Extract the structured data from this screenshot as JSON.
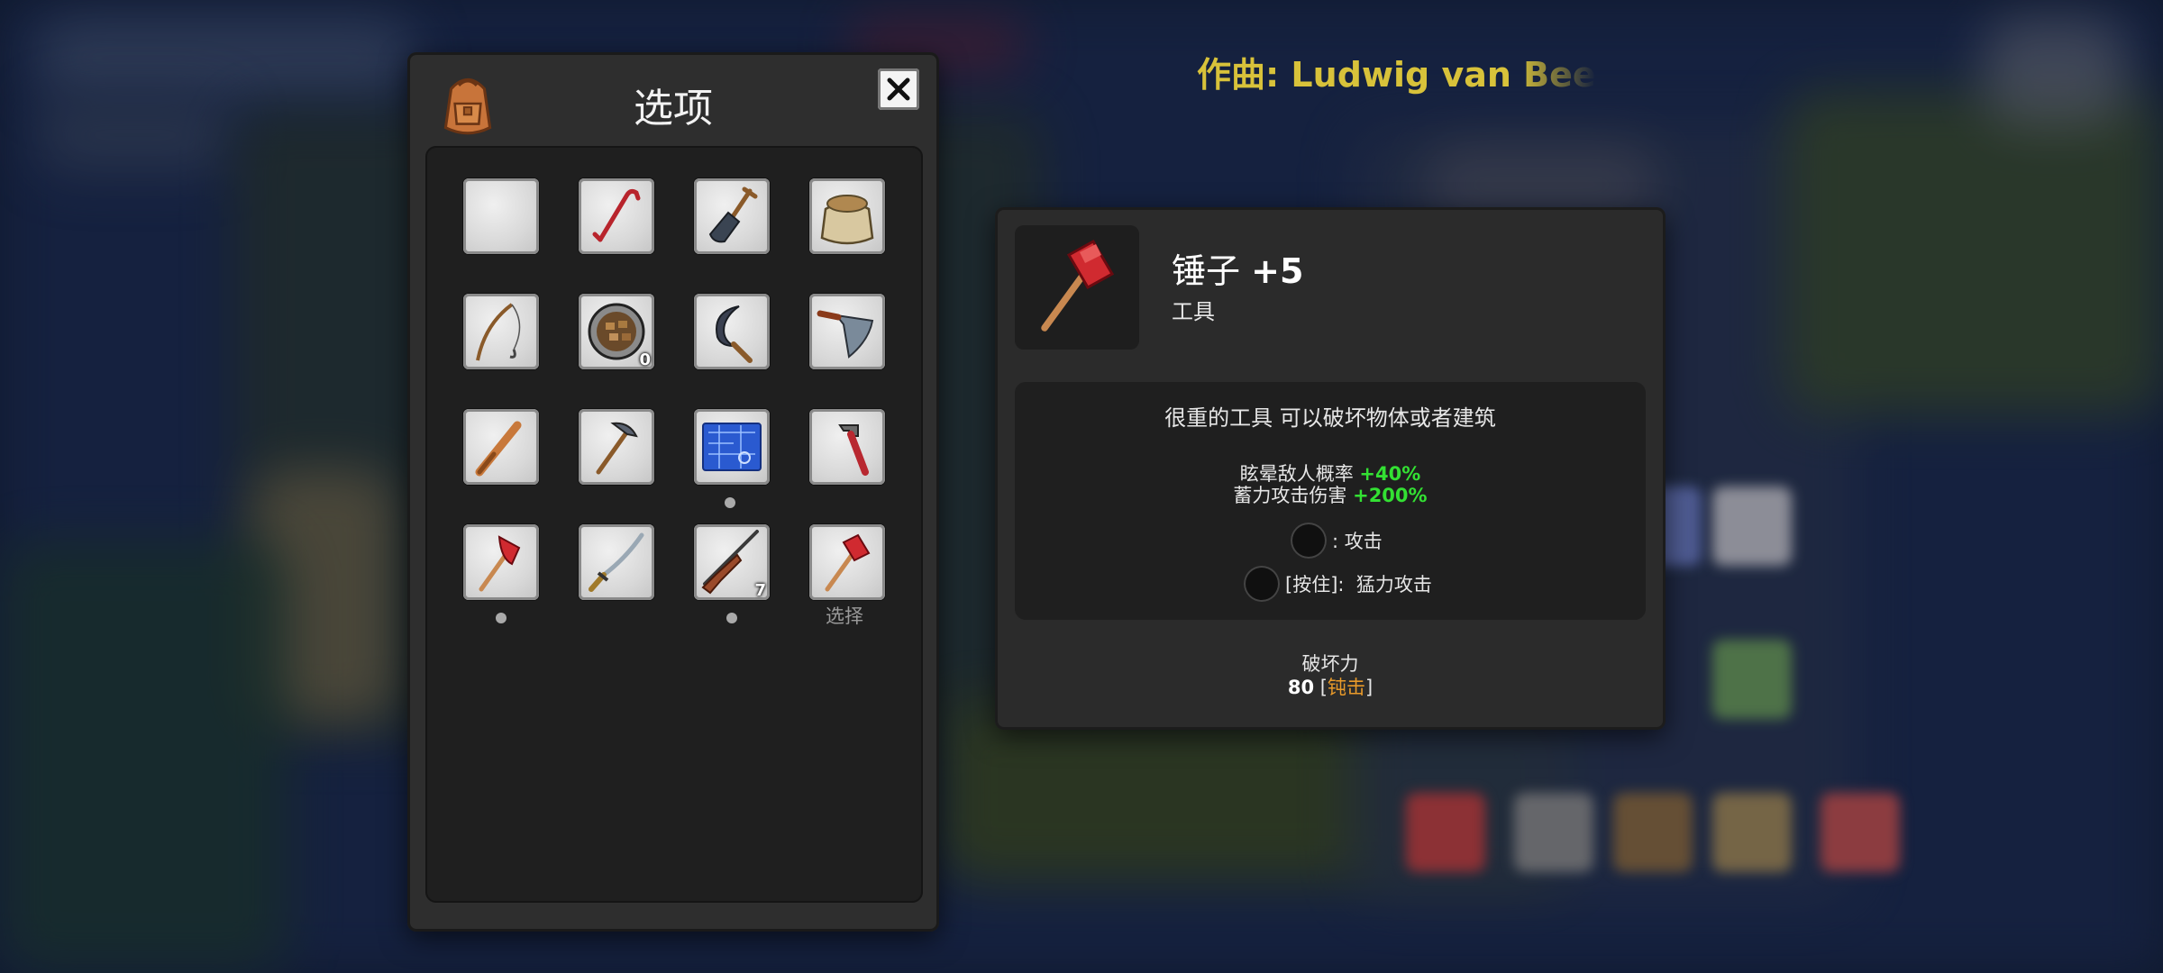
{
  "song_credit": "作曲: Ludwig van Bee",
  "inventory": {
    "title": "选项",
    "close_label": "X",
    "slots": [
      {
        "icon": "empty-slot"
      },
      {
        "icon": "crowbar-icon"
      },
      {
        "icon": "shovel-icon"
      },
      {
        "icon": "sack-icon"
      },
      {
        "icon": "fishing-rod-icon"
      },
      {
        "icon": "food-bowl-icon",
        "count": "0"
      },
      {
        "icon": "sickle-icon"
      },
      {
        "icon": "machete-icon"
      },
      {
        "icon": "baseball-bat-icon"
      },
      {
        "icon": "pickaxe-icon"
      },
      {
        "icon": "blueprint-icon"
      },
      {
        "icon": "pipe-wrench-icon"
      },
      {
        "icon": "fire-axe-icon"
      },
      {
        "icon": "katana-icon"
      },
      {
        "icon": "rifle-icon",
        "count": "7"
      },
      {
        "icon": "sledgehammer-icon"
      }
    ],
    "select_label": "选择"
  },
  "detail": {
    "icon": "sledgehammer-icon",
    "name": "锤子",
    "level": "+5",
    "type": "工具",
    "description": "很重的工具 可以破坏物体或者建筑",
    "stats": [
      {
        "label": "眩晕敌人概率",
        "value": "+40%"
      },
      {
        "label": "蓄力攻击伤害",
        "value": "+200%"
      }
    ],
    "controls": {
      "attack": ": 攻击",
      "hold_prefix": "[按住]:",
      "heavy_attack": "猛力攻击"
    },
    "power_label": "破坏力",
    "power_value": "80",
    "power_type": "钝击"
  },
  "colors": {
    "accent_green": "#33e033",
    "accent_orange": "#e89a2a",
    "song_yellow": "#d8c23a"
  }
}
